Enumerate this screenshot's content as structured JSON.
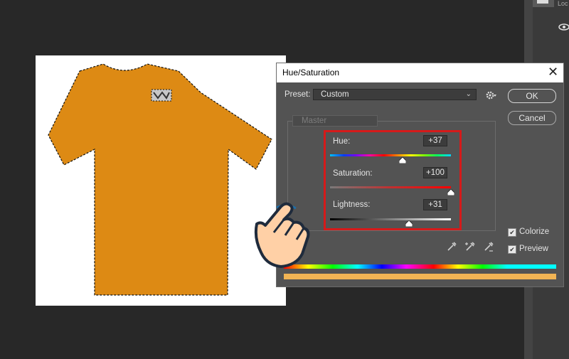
{
  "right_panel": {
    "lock_label": "Loc"
  },
  "dialog": {
    "title": "Hue/Saturation",
    "close_symbol": "✕",
    "preset": {
      "label": "Preset:",
      "value": "Custom"
    },
    "buttons": {
      "ok": "OK",
      "cancel": "Cancel"
    },
    "channel": {
      "value": "Master"
    },
    "sliders": {
      "hue": {
        "label": "Hue:",
        "value": "+37",
        "range": [
          -180,
          180
        ],
        "level": 37
      },
      "saturation": {
        "label": "Saturation:",
        "value": "+100",
        "range": [
          0,
          100
        ],
        "level": 100
      },
      "lightness": {
        "label": "Lightness:",
        "value": "+31",
        "range": [
          -100,
          100
        ],
        "level": 31
      }
    },
    "options": {
      "colorize": {
        "label": "Colorize",
        "checked": true
      },
      "preview": {
        "label": "Preview",
        "checked": true
      }
    },
    "result_color": "#f1b454",
    "highlight_color": "#d51a1a"
  },
  "canvas": {
    "shirt_color": "#dd8a14"
  },
  "icons": [
    "settings-gear-icon",
    "chevron-down-icon",
    "eyedropper-icon",
    "eyedropper-plus-icon",
    "eyedropper-minus-icon",
    "pointing-hand-icon",
    "eye-icon"
  ]
}
